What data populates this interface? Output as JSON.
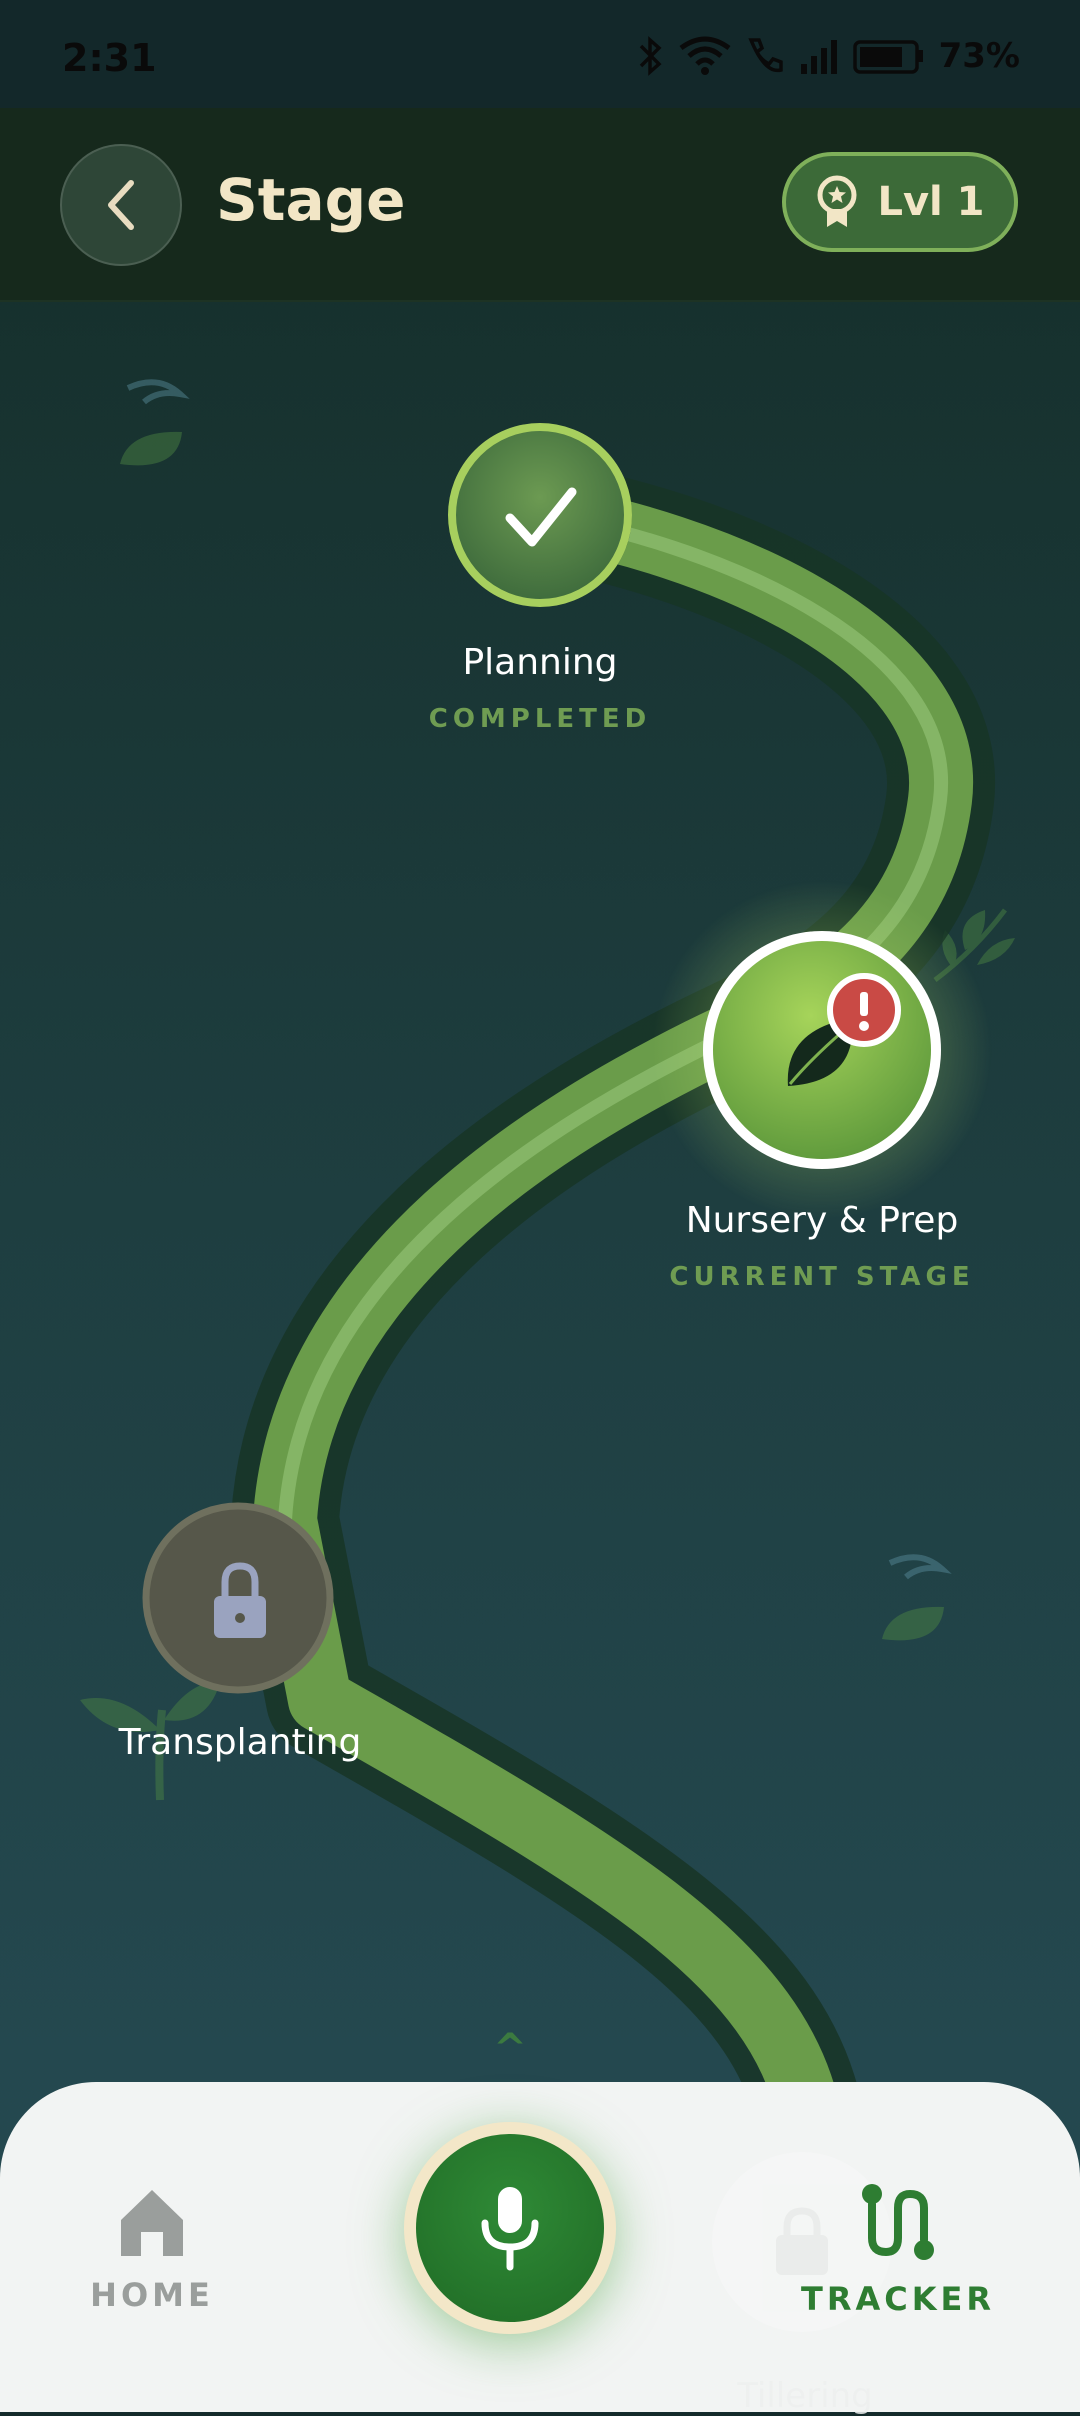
{
  "status_bar": {
    "time": "2:31",
    "battery": "73%"
  },
  "header": {
    "title": "Stage",
    "level": "Lvl 1"
  },
  "stages": [
    {
      "name": "Planning",
      "status": "COMPLETED"
    },
    {
      "name": "Nursery & Prep",
      "status": "CURRENT STAGE"
    },
    {
      "name": "Transplanting",
      "status": ""
    },
    {
      "name": "Tillering",
      "status": ""
    }
  ],
  "scroll_hint": "^",
  "nav": {
    "home": "HOME",
    "tracker": "TRACKER"
  },
  "colors": {
    "accent": "#2e7d32",
    "path": "#6a9c4a",
    "alert": "#c94a45"
  }
}
